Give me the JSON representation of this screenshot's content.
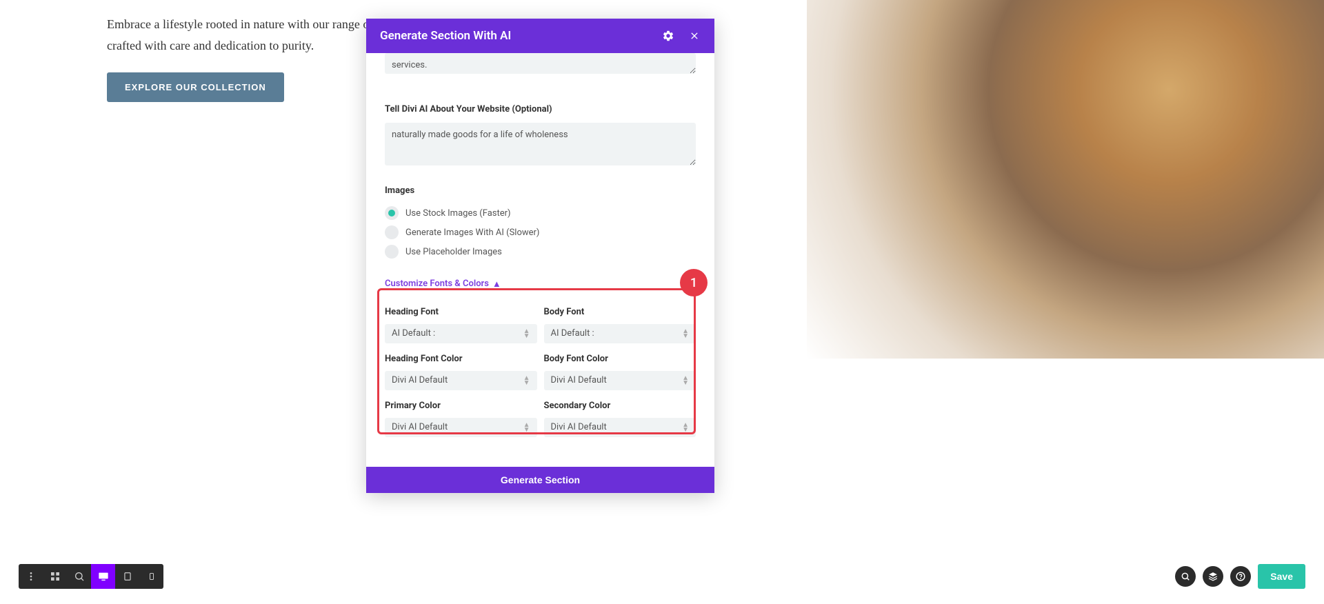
{
  "hero": {
    "text": "Embrace a lifestyle rooted in nature with our range of homemade goods, crafted with care and dedication to purity.",
    "button": "EXPLORE OUR COLLECTION"
  },
  "modal": {
    "title": "Generate Section With AI",
    "services_value": "services.",
    "website_label": "Tell Divi AI About Your Website (Optional)",
    "website_value": "naturally made goods for a life of wholeness",
    "images_title": "Images",
    "radio_options": {
      "stock": "Use Stock Images (Faster)",
      "ai": "Generate Images With AI (Slower)",
      "placeholder": "Use Placeholder Images"
    },
    "customize_link": "Customize Fonts & Colors",
    "fonts_colors": {
      "heading_font_label": "Heading Font",
      "heading_font_value": "AI Default :",
      "body_font_label": "Body Font",
      "body_font_value": "AI Default :",
      "heading_color_label": "Heading Font Color",
      "heading_color_value": "Divi AI Default",
      "body_color_label": "Body Font Color",
      "body_color_value": "Divi AI Default",
      "primary_color_label": "Primary Color",
      "primary_color_value": "Divi AI Default",
      "secondary_color_label": "Secondary Color",
      "secondary_color_value": "Divi AI Default"
    },
    "generate_button": "Generate Section"
  },
  "annotation": {
    "marker_1": "1"
  },
  "bottom_bar": {
    "save": "Save"
  }
}
